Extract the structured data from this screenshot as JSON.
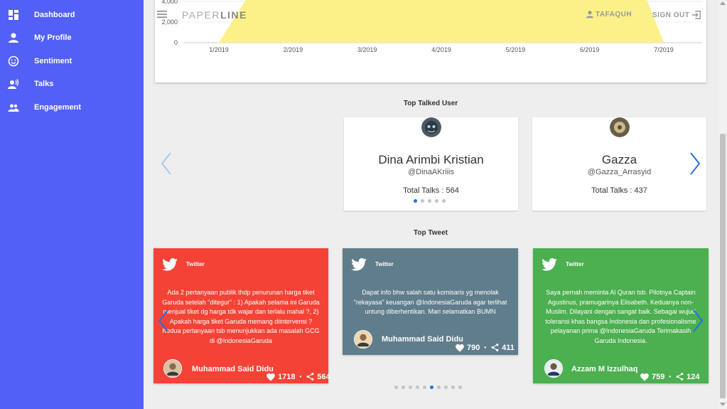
{
  "sidebar": {
    "items": [
      {
        "label": "Dashboard",
        "icon": "dashboard-icon"
      },
      {
        "label": "My Profile",
        "icon": "person-icon"
      },
      {
        "label": "Sentiment",
        "icon": "smiley-icon"
      },
      {
        "label": "Talks",
        "icon": "voice-icon"
      },
      {
        "label": "Engagement",
        "icon": "people-icon"
      }
    ]
  },
  "header": {
    "brand_light": "PAPER",
    "brand_bold": "LINE",
    "user_name": "TAFAQUH",
    "sign_out": "SIGN OUT"
  },
  "chart_data": {
    "type": "area",
    "categories": [
      "1/2019",
      "2/2019",
      "3/2019",
      "4/2019",
      "5/2019",
      "6/2019",
      "7/2019"
    ],
    "y_ticks": [
      "0",
      "2,000",
      "4,000"
    ],
    "ylim": [
      0,
      4000
    ],
    "series_color": "#fbf188"
  },
  "top_users": {
    "title": "Top Talked User",
    "users": [
      {
        "name": "Dina Arimbi Kristian",
        "handle": "@DinaAKriiis",
        "talks": "Total Talks : 564"
      },
      {
        "name": "Gazza",
        "handle": "@Gazza_Arrasyid",
        "talks": "Total Talks : 437"
      }
    ]
  },
  "top_tweets": {
    "title": "Top Tweet",
    "tweets": [
      {
        "source": "Twitter",
        "text": "Ada 2 pertanyaan publik thdp penurunan harga tiket Garuda setelah \"ditegur\" : 1) Apakah selama ini Garuda menjual tiket dg harga tdk wajar dan terlalu mahal ?, 2) Apakah harga tiket Garuda memang diintervensi ? Kedua pertanyaan tsb menunjukkan ada masalah GCG di @IndonesiaGaruda",
        "author": "Muhammad Said Didu",
        "likes": "1718",
        "shares": "564",
        "color": "#f44336"
      },
      {
        "source": "Twitter",
        "text": "Dapat info bhw salah satu komisaris yg menolak \"rekayasa\" keuangan @IndonesiaGaruda agar terlihat untung diberhentikan. Mari selamatkan BUMN",
        "author": "Muhammad Said Didu",
        "likes": "790",
        "shares": "411",
        "color": "#607d8b"
      },
      {
        "source": "Twitter",
        "text": "Saya pernah meminta Al Quran tsb. Pilotnya Captain Agustinus, pramugarinya Elisabeth. Keduanya non-Muslim. Dilayani dengan sangat baik. Sebagai wujud toleransi khas bangsa Indonesia dan profesionalisme pelayanan prima @IndonesiaGaruda Terimakasih Garuda Indonesia.",
        "author": "Azzam M Izzulhaq",
        "likes": "759",
        "shares": "124",
        "color": "#4caf50"
      }
    ]
  }
}
